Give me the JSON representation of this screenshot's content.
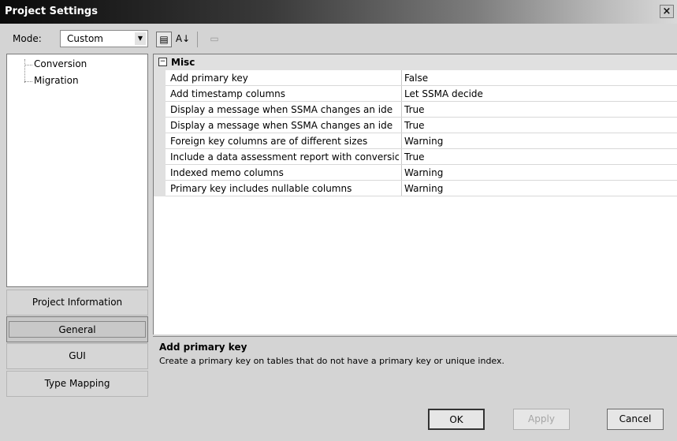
{
  "window": {
    "title": "Project Settings",
    "close_glyph": "×"
  },
  "mode": {
    "label": "Mode:",
    "value": "Custom"
  },
  "toolbar": {
    "categorized_glyph": "▤",
    "alphabetical_glyph": "A↓",
    "property_pages_glyph": "▭"
  },
  "tree": {
    "items": [
      {
        "label": "Conversion"
      },
      {
        "label": "Migration"
      }
    ]
  },
  "nav": {
    "project_information": "Project Information",
    "general": "General",
    "gui": "GUI",
    "type_mapping": "Type Mapping",
    "active": "General"
  },
  "grid": {
    "category": {
      "toggle": "−",
      "label": "Misc"
    },
    "rows": [
      {
        "name": "Add primary key",
        "value": "False"
      },
      {
        "name": "Add timestamp columns",
        "value": "Let SSMA decide"
      },
      {
        "name": "Display a message when SSMA changes an ide",
        "value": "True"
      },
      {
        "name": "Display a message when SSMA changes an ide",
        "value": "True"
      },
      {
        "name": "Foreign key columns are of different sizes",
        "value": "Warning"
      },
      {
        "name": "Include a data assessment report with conversic",
        "value": "True"
      },
      {
        "name": "Indexed memo columns",
        "value": "Warning"
      },
      {
        "name": "Primary key includes nullable columns",
        "value": "Warning"
      }
    ]
  },
  "description": {
    "title": "Add primary key",
    "text": "Create a primary key on tables that do not have a primary key or unique index."
  },
  "buttons": {
    "ok": "OK",
    "apply": "Apply",
    "cancel": "Cancel"
  }
}
